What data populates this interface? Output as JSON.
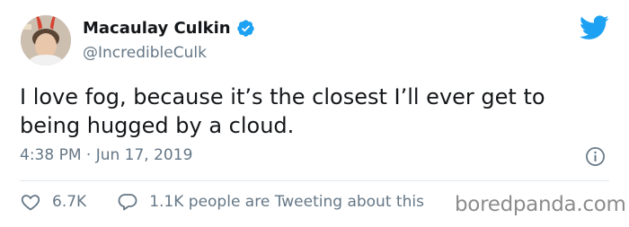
{
  "tweet": {
    "author_name": "Macaulay Culkin",
    "handle": "@IncredibleCulk",
    "text": "I love fog, because it’s the closest I’ll ever get to being hugged by a cloud.",
    "timestamp": "4:38 PM · Jun 17, 2019",
    "like_count": "6.7K",
    "tweeting_label": "1.1K people are Tweeting about this"
  },
  "watermark": "boredpanda.com",
  "colors": {
    "brand": "#1da1f2",
    "secondary_text": "#657786",
    "divider": "#e1e8ed"
  },
  "icons": [
    "verified-badge-icon",
    "twitter-bird-icon",
    "info-icon",
    "heart-icon",
    "speech-bubble-icon"
  ]
}
